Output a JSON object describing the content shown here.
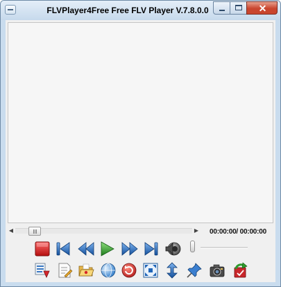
{
  "window": {
    "title": "FLVPlayer4Free Free FLV Player V.7.8.0.0",
    "close_glyph": "✕"
  },
  "player": {
    "time_display": "00:00:00/ 00:00:00"
  },
  "icons": {
    "transport": [
      "stop-icon",
      "previous-track-icon",
      "rewind-icon",
      "play-icon",
      "fast-forward-icon",
      "next-track-icon",
      "volume-speaker-icon"
    ],
    "toolbar": [
      "open-playlist-icon",
      "edit-document-icon",
      "open-folder-icon",
      "web-globe-icon",
      "repeat-icon",
      "fullscreen-icon",
      "resize-height-icon",
      "pin-on-top-icon",
      "snapshot-camera-icon",
      "refresh-update-icon"
    ]
  },
  "colors": {
    "titlebar": "#c6d9ec",
    "close_button": "#c9452e",
    "stop": "#d21d1d",
    "play": "#2e9a2c",
    "nav_blue": "#1e64b8"
  }
}
